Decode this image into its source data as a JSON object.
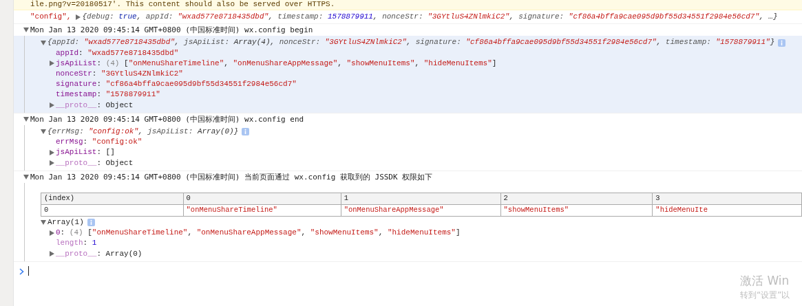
{
  "warning": {
    "link": "ile.png?v=20180517",
    "text": "'. This content should also be served over HTTPS."
  },
  "entries": [
    {
      "kind": "log",
      "lead": [
        {
          "kind": "string",
          "text": "\"config\","
        }
      ],
      "expanded": false,
      "tokens": [
        {
          "kind": "p-plain",
          "text": "{"
        },
        {
          "kind": "p-key",
          "text": "debug: "
        },
        {
          "kind": "p-keyword",
          "text": "true"
        },
        {
          "kind": "p-plain",
          "text": ", "
        },
        {
          "kind": "p-key",
          "text": "appId: "
        },
        {
          "kind": "p-string",
          "text": "\"wxad577e8718435dbd\""
        },
        {
          "kind": "p-plain",
          "text": ", "
        },
        {
          "kind": "p-key",
          "text": "timestamp: "
        },
        {
          "kind": "p-number",
          "text": "1578879911"
        },
        {
          "kind": "p-plain",
          "text": ", "
        },
        {
          "kind": "p-key",
          "text": "nonceStr: "
        },
        {
          "kind": "p-string",
          "text": "\"3GYtluS4ZNlmkiC2\""
        },
        {
          "kind": "p-plain",
          "text": ", "
        },
        {
          "kind": "p-key",
          "text": "signature: "
        },
        {
          "kind": "p-string",
          "text": "\"cf86a4bffa9cae095d9bf55d34551f2984e56cd7\""
        },
        {
          "kind": "p-plain",
          "text": ", …}"
        }
      ]
    },
    {
      "kind": "group",
      "expanded": true,
      "highlighted": true,
      "title": "Mon Jan 13 2020 09:45:14 GMT+0800 (中国标准时间) wx.config begin",
      "children": [
        {
          "kind": "object",
          "expanded": true,
          "info": true,
          "tokens": [
            {
              "kind": "p-plain",
              "text": "{"
            },
            {
              "kind": "p-key",
              "text": "appId: "
            },
            {
              "kind": "p-string",
              "text": "\"wxad577e8718435dbd\""
            },
            {
              "kind": "p-plain",
              "text": ", "
            },
            {
              "kind": "p-key",
              "text": "jsApiList: "
            },
            {
              "kind": "p-plain",
              "text": "Array(4)"
            },
            {
              "kind": "p-plain",
              "text": ", "
            },
            {
              "kind": "p-key",
              "text": "nonceStr: "
            },
            {
              "kind": "p-string",
              "text": "\"3GYtluS4ZNlmkiC2\""
            },
            {
              "kind": "p-plain",
              "text": ", "
            },
            {
              "kind": "p-key",
              "text": "signature: "
            },
            {
              "kind": "p-string",
              "text": "\"cf86a4bffa9cae095d9bf55d34551f2984e56cd7\""
            },
            {
              "kind": "p-plain",
              "text": ", "
            },
            {
              "kind": "p-key",
              "text": "timestamp: "
            },
            {
              "kind": "p-string",
              "text": "\"1578879911\""
            },
            {
              "kind": "p-plain",
              "text": "}"
            }
          ],
          "children": [
            {
              "tokens": [
                {
                  "kind": "key",
                  "text": "appId"
                },
                {
                  "kind": "plain",
                  "text": ": "
                },
                {
                  "kind": "string",
                  "text": "\"wxad577e8718435dbd\""
                }
              ]
            },
            {
              "expanded": false,
              "tokens": [
                {
                  "kind": "key",
                  "text": "jsApiList"
                },
                {
                  "kind": "plain",
                  "text": ": "
                },
                {
                  "kind": "count",
                  "text": "(4) "
                },
                {
                  "kind": "plain",
                  "text": "["
                },
                {
                  "kind": "string",
                  "text": "\"onMenuShareTimeline\""
                },
                {
                  "kind": "plain",
                  "text": ", "
                },
                {
                  "kind": "string",
                  "text": "\"onMenuShareAppMessage\""
                },
                {
                  "kind": "plain",
                  "text": ", "
                },
                {
                  "kind": "string",
                  "text": "\"showMenuItems\""
                },
                {
                  "kind": "plain",
                  "text": ", "
                },
                {
                  "kind": "string",
                  "text": "\"hideMenuItems\""
                },
                {
                  "kind": "plain",
                  "text": "]"
                }
              ]
            },
            {
              "tokens": [
                {
                  "kind": "key",
                  "text": "nonceStr"
                },
                {
                  "kind": "plain",
                  "text": ": "
                },
                {
                  "kind": "string",
                  "text": "\"3GYtluS4ZNlmkiC2\""
                }
              ]
            },
            {
              "tokens": [
                {
                  "kind": "key",
                  "text": "signature"
                },
                {
                  "kind": "plain",
                  "text": ": "
                },
                {
                  "kind": "string",
                  "text": "\"cf86a4bffa9cae095d9bf55d34551f2984e56cd7\""
                }
              ]
            },
            {
              "tokens": [
                {
                  "kind": "key",
                  "text": "timestamp"
                },
                {
                  "kind": "plain",
                  "text": ": "
                },
                {
                  "kind": "string",
                  "text": "\"1578879911\""
                }
              ]
            },
            {
              "expanded": false,
              "tokens": [
                {
                  "kind": "dim-key",
                  "text": "__proto__"
                },
                {
                  "kind": "plain",
                  "text": ": Object"
                }
              ]
            }
          ]
        }
      ]
    },
    {
      "kind": "group",
      "expanded": true,
      "highlighted": false,
      "title": "Mon Jan 13 2020 09:45:14 GMT+0800 (中国标准时间) wx.config end",
      "children": [
        {
          "kind": "object",
          "expanded": true,
          "info": true,
          "tokens": [
            {
              "kind": "p-plain",
              "text": "{"
            },
            {
              "kind": "p-key",
              "text": "errMsg: "
            },
            {
              "kind": "p-string",
              "text": "\"config:ok\""
            },
            {
              "kind": "p-plain",
              "text": ", "
            },
            {
              "kind": "p-key",
              "text": "jsApiList: "
            },
            {
              "kind": "p-plain",
              "text": "Array(0)}"
            }
          ],
          "children": [
            {
              "tokens": [
                {
                  "kind": "key",
                  "text": "errMsg"
                },
                {
                  "kind": "plain",
                  "text": ": "
                },
                {
                  "kind": "string",
                  "text": "\"config:ok\""
                }
              ]
            },
            {
              "expanded": false,
              "tokens": [
                {
                  "kind": "key",
                  "text": "jsApiList"
                },
                {
                  "kind": "plain",
                  "text": ": []"
                }
              ]
            },
            {
              "expanded": false,
              "tokens": [
                {
                  "kind": "dim-key",
                  "text": "__proto__"
                },
                {
                  "kind": "plain",
                  "text": ": Object"
                }
              ]
            }
          ]
        }
      ]
    },
    {
      "kind": "group",
      "expanded": true,
      "highlighted": false,
      "title": "Mon Jan 13 2020 09:45:14 GMT+0800 (中国标准时间) 当前页面通过 wx.config 获取到的 JSSDK 权限如下",
      "children": [
        {
          "kind": "table",
          "columns": [
            "(index)",
            "0",
            "1",
            "2",
            "3"
          ],
          "rows": [
            [
              "0",
              "\"onMenuShareTimeline\"",
              "\"onMenuShareAppMessage\"",
              "\"showMenuItems\"",
              "\"hideMenuIte"
            ]
          ]
        },
        {
          "kind": "object",
          "expanded": true,
          "info": true,
          "tokens": [
            {
              "kind": "plain",
              "text": "Array(1)"
            }
          ],
          "children": [
            {
              "expanded": false,
              "tokens": [
                {
                  "kind": "key",
                  "text": "0"
                },
                {
                  "kind": "plain",
                  "text": ": "
                },
                {
                  "kind": "count",
                  "text": "(4) "
                },
                {
                  "kind": "plain",
                  "text": "["
                },
                {
                  "kind": "string",
                  "text": "\"onMenuShareTimeline\""
                },
                {
                  "kind": "plain",
                  "text": ", "
                },
                {
                  "kind": "string",
                  "text": "\"onMenuShareAppMessage\""
                },
                {
                  "kind": "plain",
                  "text": ", "
                },
                {
                  "kind": "string",
                  "text": "\"showMenuItems\""
                },
                {
                  "kind": "plain",
                  "text": ", "
                },
                {
                  "kind": "string",
                  "text": "\"hideMenuItems\""
                },
                {
                  "kind": "plain",
                  "text": "]"
                }
              ]
            },
            {
              "tokens": [
                {
                  "kind": "dim-key",
                  "text": "length"
                },
                {
                  "kind": "plain",
                  "text": ": "
                },
                {
                  "kind": "number",
                  "text": "1"
                }
              ]
            },
            {
              "expanded": false,
              "tokens": [
                {
                  "kind": "dim-key",
                  "text": "__proto__"
                },
                {
                  "kind": "plain",
                  "text": ": Array(0)"
                }
              ]
            }
          ]
        }
      ]
    },
    {
      "kind": "prompt"
    }
  ],
  "activation": {
    "title": "激活 Win",
    "hint": "转到“设置”以"
  }
}
